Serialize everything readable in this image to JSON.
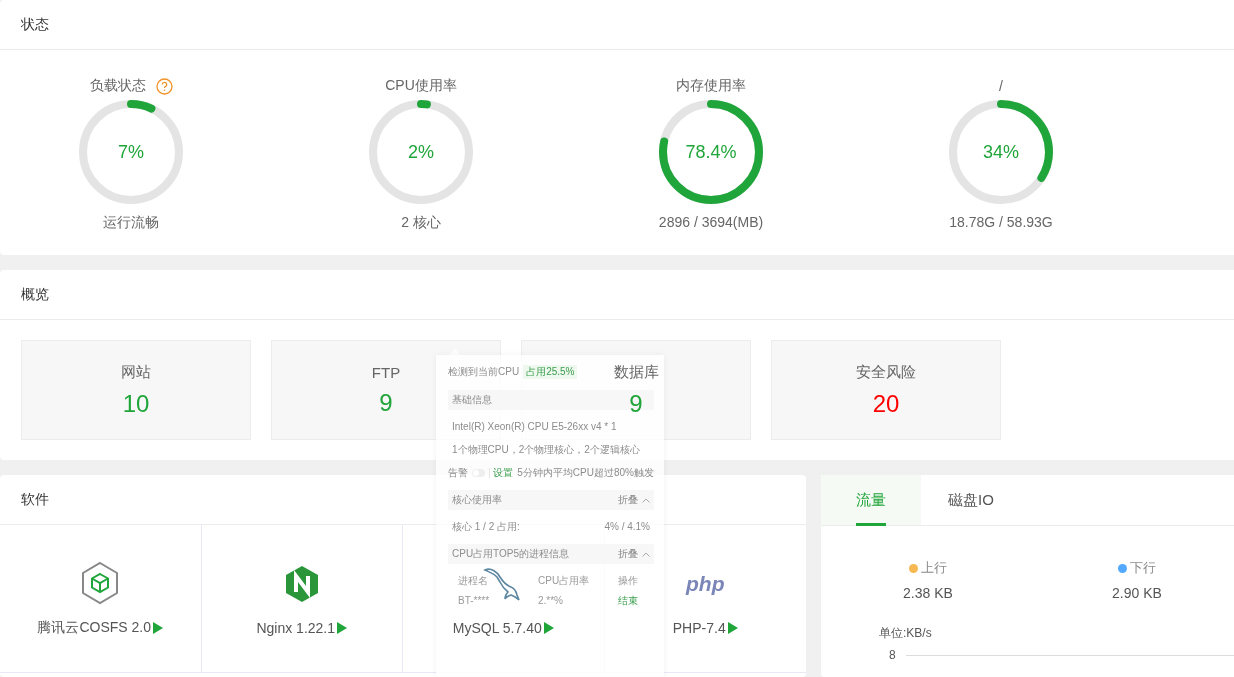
{
  "status": {
    "title": "状态",
    "gauges": [
      {
        "label": "负载状态",
        "help": true,
        "level": 0.07,
        "value": "7%",
        "sub": "运行流畅"
      },
      {
        "label": "CPU使用率",
        "help": false,
        "level": 0.02,
        "value": "2%",
        "sub": "2 核心"
      },
      {
        "label": "内存使用率",
        "help": false,
        "level": 0.784,
        "value": "78.4%",
        "sub": "2896 / 3694(MB)"
      },
      {
        "label": "/",
        "help": false,
        "level": 0.34,
        "value": "34%",
        "sub": "18.78G / 58.93G"
      }
    ]
  },
  "overview": {
    "title": "概览",
    "cards": [
      {
        "label": "网站",
        "value": "10",
        "color": "#20a53a"
      },
      {
        "label": "FTP",
        "value": "9",
        "color": "#20a53a"
      },
      {
        "label": "数据库",
        "value": "9",
        "color": "#20a53a"
      },
      {
        "label": "安全风险",
        "value": "20",
        "color": "#ff0000"
      }
    ]
  },
  "software": {
    "title": "软件",
    "items": [
      {
        "kind": "cube",
        "name": "腾讯云COSFS 2.0"
      },
      {
        "kind": "nginx",
        "name": "Nginx 1.22.1"
      },
      {
        "kind": "dolphin",
        "name": "MySQL 5.7.40"
      },
      {
        "kind": "php",
        "logo_text": "php",
        "name": "PHP-7.4"
      }
    ]
  },
  "traffic": {
    "tabs": [
      {
        "label": "流量",
        "selected": true
      },
      {
        "label": "磁盘IO",
        "selected": false
      }
    ],
    "stats": [
      {
        "label": "上行",
        "value": "2.38 KB",
        "color": "#f7b851"
      },
      {
        "label": "下行",
        "value": "2.90 KB",
        "color": "#52a9ff"
      }
    ],
    "unit": "单位:KB/s",
    "ytick": "8"
  },
  "cpu_popup": {
    "title": "检测到当前CPU",
    "badge": "占用25.5%",
    "basic_title": "基础信息",
    "model": "Intel(R) Xeon(R) CPU E5-26xx v4 * 1",
    "topology": "1个物理CPU，2个物理核心，2个逻辑核心",
    "alarm_label": "告警",
    "alarm_on": false,
    "alarm_link": "设置",
    "alarm_rule": "5分钟内平均CPU超过80%触发",
    "core_title": "核心使用率",
    "core_toggle": "折叠",
    "core_label": "核心 1 / 2 占用:",
    "core_value": "4% / 4.1%",
    "top_title": "CPU占用TOP5的进程信息",
    "top_toggle": "折叠",
    "columns": [
      "进程名",
      "CPU占用率",
      "操作"
    ],
    "rows": [
      {
        "name": "BT-****",
        "cpu": "2.**%",
        "action": "结束"
      }
    ]
  }
}
